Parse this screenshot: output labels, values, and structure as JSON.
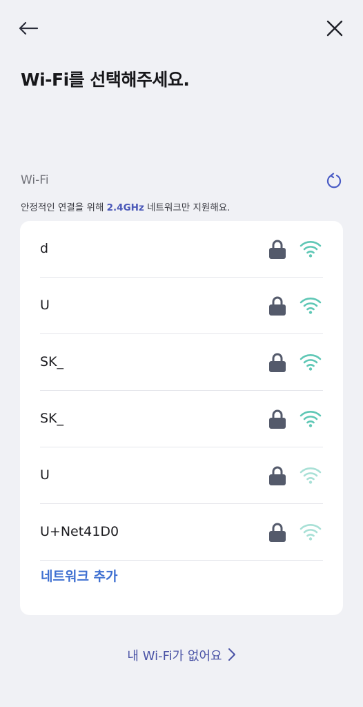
{
  "header": {
    "back_icon": "back-arrow-icon",
    "close_icon": "close-icon",
    "title": "Wi-Fi를 선택해주세요."
  },
  "wifi_section": {
    "label": "Wi-Fi",
    "refresh_icon": "refresh-icon",
    "note_prefix": "안정적인 연결을 위해 ",
    "note_highlight": "2.4GHz",
    "note_suffix": " 네트워크만 지원해요.",
    "accent_color": "#4a58b8"
  },
  "networks": [
    {
      "ssid": "d",
      "secured": true,
      "signal": "strong"
    },
    {
      "ssid": "U",
      "secured": true,
      "signal": "strong"
    },
    {
      "ssid": "SK_",
      "secured": true,
      "signal": "strong"
    },
    {
      "ssid": "SK_",
      "secured": true,
      "signal": "strong"
    },
    {
      "ssid": "U",
      "secured": true,
      "signal": "weak"
    },
    {
      "ssid": "U+Net41D0",
      "secured": true,
      "signal": "weak"
    }
  ],
  "add_network_label": "네트워크 추가",
  "no_wifi_link": "내 Wi-Fi가 없어요",
  "colors": {
    "background": "#f0f1f5",
    "card": "#ffffff",
    "wifi_strong": "#5ec7b5",
    "wifi_weak": "#a8e0d6",
    "lock": "#545a6b",
    "link": "#3e6fd1"
  }
}
